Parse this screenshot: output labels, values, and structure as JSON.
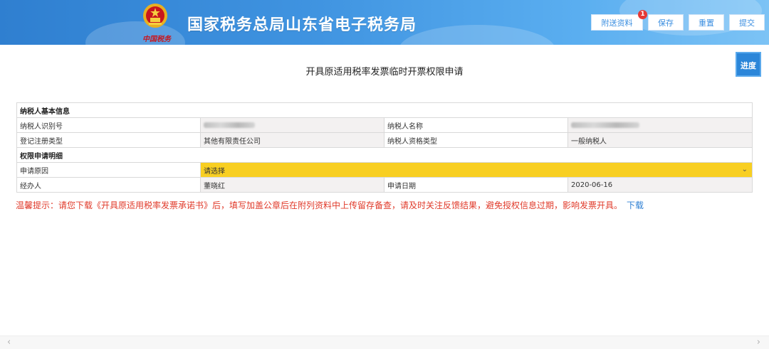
{
  "header": {
    "site_title": "国家税务总局山东省电子税务局",
    "logo_script": "中国税务",
    "toolbar": {
      "attach_label": "附送资料",
      "attach_badge": "1",
      "save_label": "保存",
      "reset_label": "重置",
      "submit_label": "提交"
    }
  },
  "progress_label": "进度",
  "page_title": "开具原适用税率发票临时开票权限申请",
  "form": {
    "section_basic": "纳税人基本信息",
    "taxpayer_id_label": "纳税人识别号",
    "taxpayer_id_value_hidden": true,
    "taxpayer_name_label": "纳税人名称",
    "taxpayer_name_value_hidden": true,
    "reg_type_label": "登记注册类型",
    "reg_type_value": "其他有限责任公司",
    "qualification_label": "纳税人资格类型",
    "qualification_value": "一般纳税人",
    "section_detail": "权限申请明细",
    "reason_label": "申请原因",
    "reason_placeholder": "请选择",
    "handler_label": "经办人",
    "handler_value": "董晓红",
    "date_label": "申请日期",
    "date_value": "2020-06-16"
  },
  "tip": {
    "text": "温馨提示：请您下载《开具原适用税率发票承诺书》后，填写加盖公章后在附列资料中上传留存备查，请及时关注反馈结果，避免授权信息过期，影响发票开具。",
    "download_label": "下载"
  },
  "colors": {
    "header_blue": "#2f7fd0",
    "select_yellow": "#f8cf22",
    "tip_red": "#e03a2a",
    "link_blue": "#2d7fd3"
  },
  "icons": [
    "national-emblem-icon",
    "chevron-down-icon",
    "scroll-left-icon",
    "scroll-right-icon"
  ]
}
